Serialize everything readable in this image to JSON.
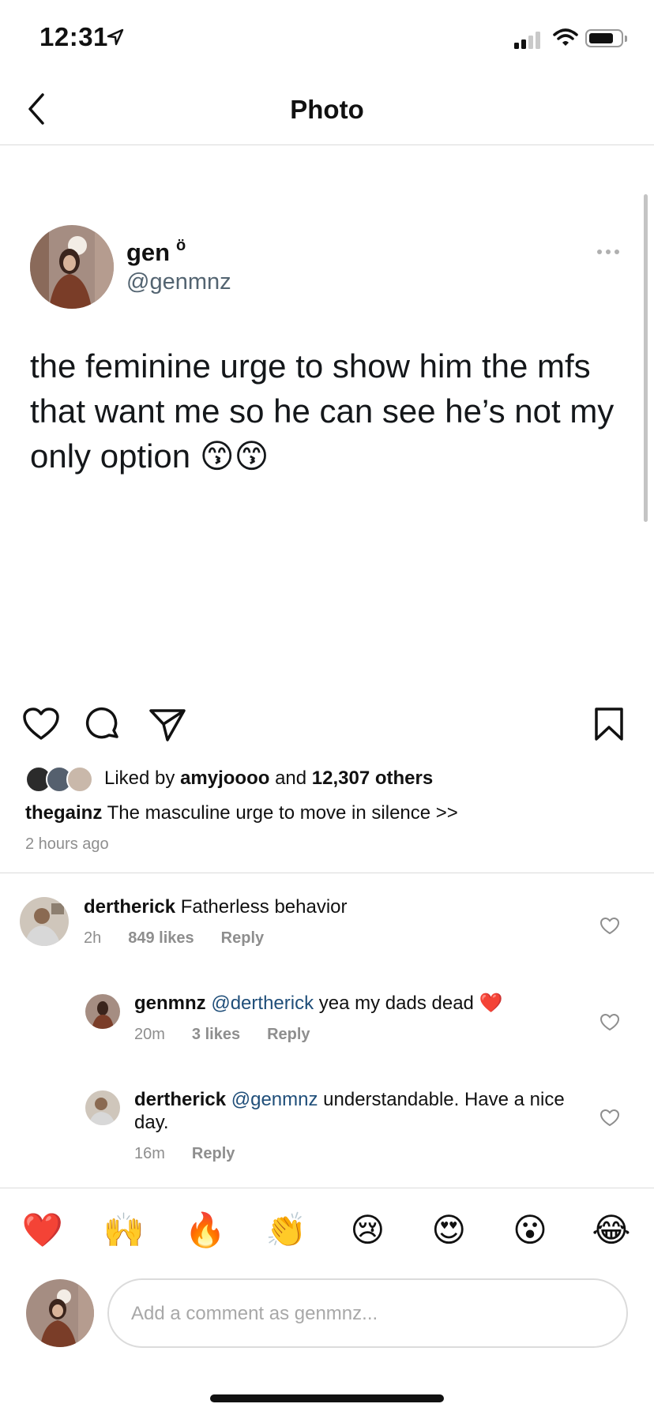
{
  "status_bar": {
    "time": "12:31"
  },
  "header": {
    "title": "Photo"
  },
  "tweet": {
    "name": "gen",
    "name_deco": "ö",
    "handle": "@genmnz",
    "text": "the feminine urge to show him the mfs that want me so he can see he’s not my only option 😙😙"
  },
  "post": {
    "liked_prefix": "Liked by ",
    "liked_user": "amyjoooo",
    "liked_middle": " and ",
    "liked_count": "12,307 others",
    "caption_user": "thegainz",
    "caption_text": " The masculine urge to move in silence >>",
    "time_ago": "2 hours ago"
  },
  "comments": [
    {
      "user": "dertherick",
      "text": " Fatherless behavior",
      "time": "2h",
      "likes": "849 likes",
      "reply": "Reply"
    },
    {
      "user": "genmnz",
      "mention": "@dertherick",
      "text": " yea my dads dead ❤️",
      "time": "20m",
      "likes": "3 likes",
      "reply": "Reply"
    },
    {
      "user": "dertherick",
      "mention": "@genmnz",
      "text": " understandable. Have a nice day.",
      "time": "16m",
      "reply": "Reply"
    }
  ],
  "emoji_bar": [
    "❤️",
    "🙌",
    "🔥",
    "👏",
    "😢",
    "😍",
    "😮",
    "😂"
  ],
  "composer": {
    "placeholder": "Add a comment as genmnz..."
  },
  "colors": {
    "mention": "#1f4e79",
    "secondary_text": "#8e8e8e",
    "handle": "#536471"
  }
}
